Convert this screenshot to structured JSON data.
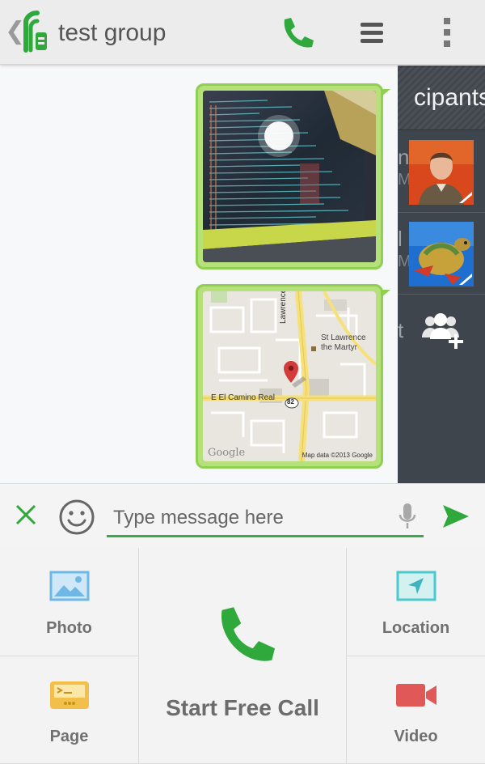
{
  "header": {
    "back_glyph": "❮",
    "title": "test group",
    "icons": [
      "app-logo-icon",
      "phone-call-icon",
      "menu-icon",
      "overflow-icon"
    ]
  },
  "messages": [
    {
      "type": "photo",
      "content": "screenshot photo"
    },
    {
      "type": "map",
      "map": {
        "street": "E El Camino Real",
        "cross_street": "Lawrence Expy",
        "place_line1": "St Lawrence",
        "place_line2": "the Martyr",
        "route_shield": "82",
        "attribution": "Map data ©2013 Google",
        "logo_text": "Google"
      }
    }
  ],
  "participants_panel": {
    "title": "cipants",
    "rows": [
      {
        "initial": "n",
        "sub": "M"
      },
      {
        "initial": "l",
        "sub": "M"
      }
    ],
    "add_row_initial": "t"
  },
  "composer": {
    "placeholder": "Type message here",
    "value": ""
  },
  "actions": {
    "photo": "Photo",
    "page": "Page",
    "call": "Start Free Call",
    "location": "Location",
    "video": "Video"
  },
  "colors": {
    "accent_green": "#2fa83c",
    "bubble_green": "#8fcf52",
    "panel_dark": "#3f454c"
  }
}
